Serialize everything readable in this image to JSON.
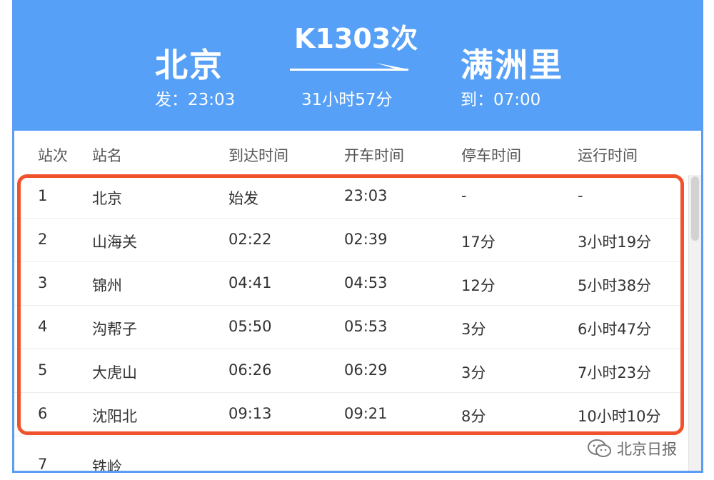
{
  "train": {
    "number": "K1303次",
    "from_city": "北京",
    "to_city": "满洲里",
    "depart_time": "发：23:03",
    "arrive_time": "到：07:00",
    "duration": "31小时57分"
  },
  "table": {
    "headers": [
      "站次",
      "站名",
      "到达时间",
      "开车时间",
      "停车时间",
      "运行时间"
    ],
    "rows": [
      [
        "1",
        "北京",
        "始发",
        "23:03",
        "-",
        "-"
      ],
      [
        "2",
        "山海关",
        "02:22",
        "02:39",
        "17分",
        "3小时19分"
      ],
      [
        "3",
        "锦州",
        "04:41",
        "04:53",
        "12分",
        "5小时38分"
      ],
      [
        "4",
        "沟帮子",
        "05:50",
        "05:53",
        "3分",
        "6小时47分"
      ],
      [
        "5",
        "大虎山",
        "06:26",
        "06:29",
        "3分",
        "7小时23分"
      ],
      [
        "6",
        "沈阳北",
        "09:13",
        "09:21",
        "8分",
        "10小时10分"
      ]
    ],
    "partial_row": [
      "7",
      "铁岭"
    ]
  },
  "watermark": {
    "text": "北京日报",
    "icon": "wechat-icon"
  },
  "colors": {
    "header_bg": "#56a0f7",
    "highlight": "#f0522b"
  }
}
